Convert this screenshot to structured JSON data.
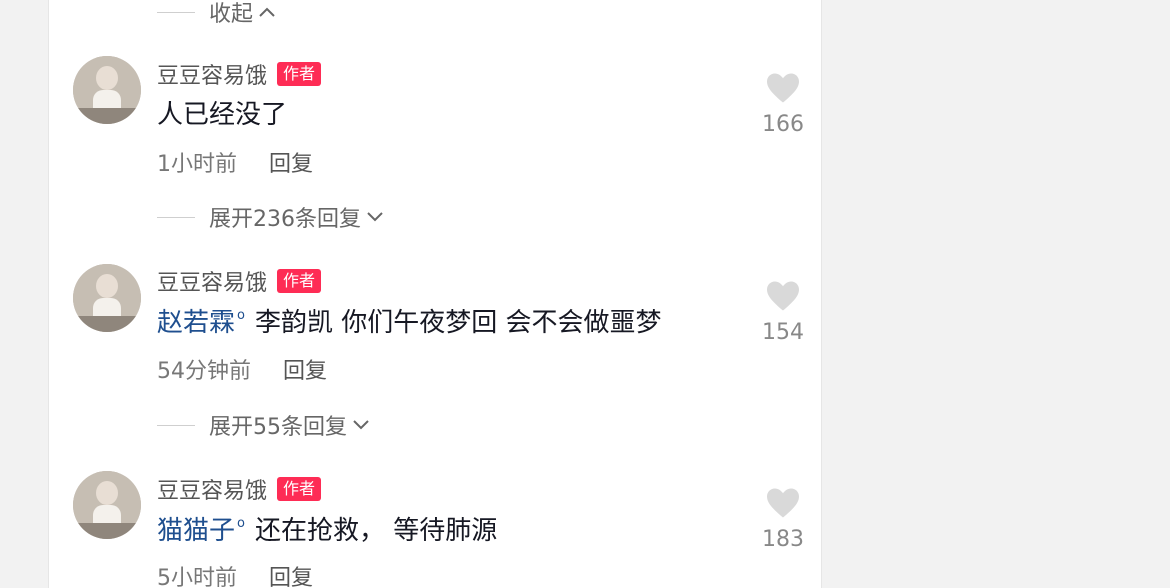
{
  "collapse_label": "收起",
  "author_badge": "作者",
  "reply_label": "回复",
  "comments": [
    {
      "username": "豆豆容易饿",
      "mention": "",
      "text": "人已经没了",
      "time": "1小时前",
      "likes": "166",
      "expand_label": "展开236条回复"
    },
    {
      "username": "豆豆容易饿",
      "mention": "赵若霖",
      "text": "李韵凯 你们午夜梦回 会不会做噩梦",
      "time": "54分钟前",
      "likes": "154",
      "expand_label": "展开55条回复"
    },
    {
      "username": "豆豆容易饿",
      "mention": "猫猫子",
      "text": "还在抢救， 等待肺源",
      "time": "5小时前",
      "likes": "183"
    }
  ],
  "colors": {
    "badge": "#fe2c55",
    "mention": "#1f4f8f",
    "heart": "#d9d9d9"
  },
  "icons": {
    "heart": "heart-icon",
    "chevron_up": "chevron-up-icon",
    "chevron_down": "chevron-down-icon"
  }
}
